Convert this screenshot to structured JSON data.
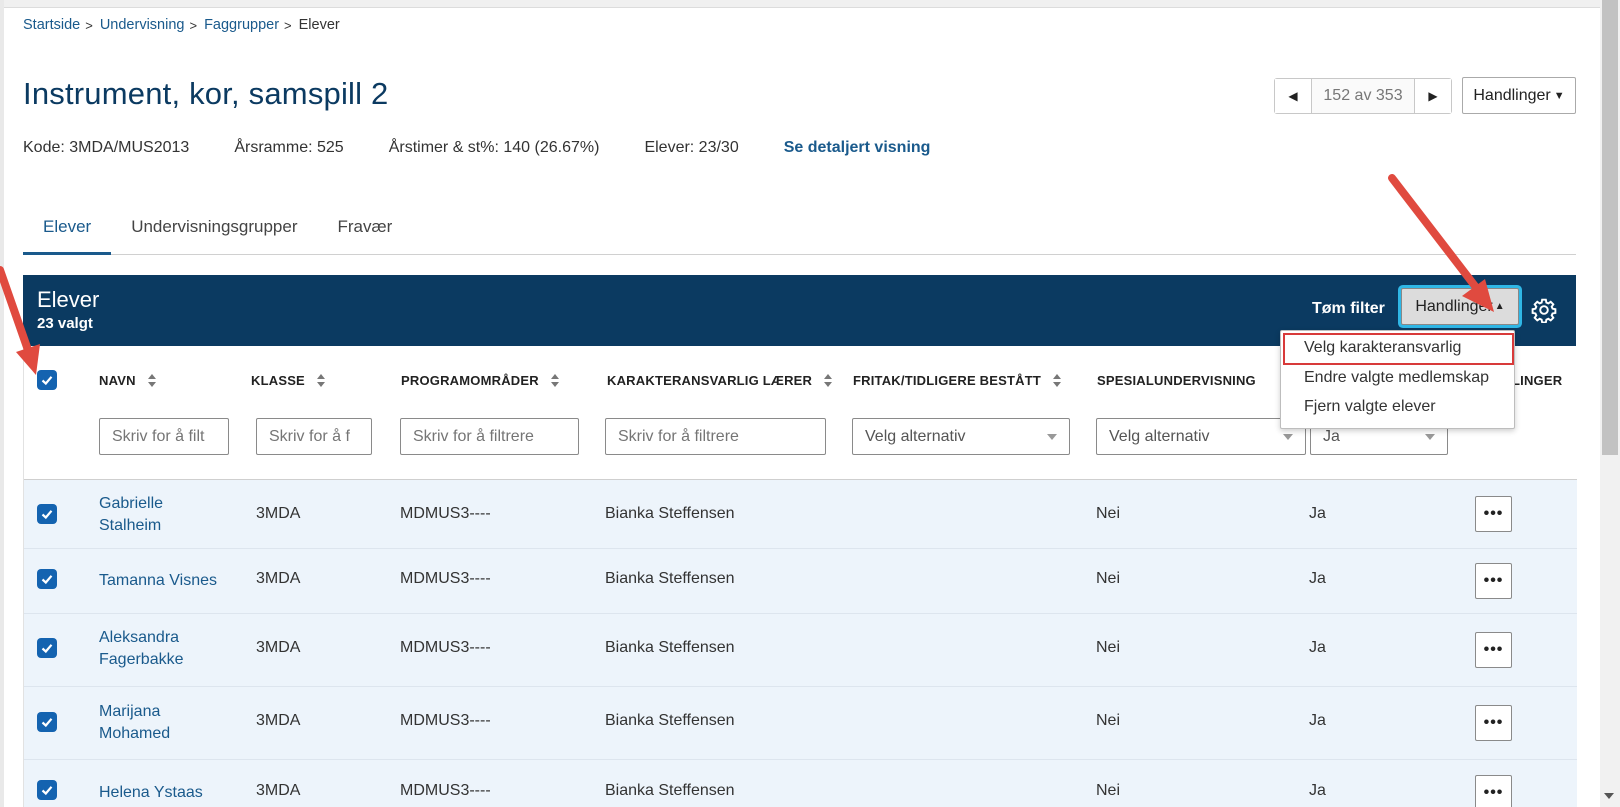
{
  "breadcrumb": [
    {
      "label": "Startside"
    },
    {
      "label": "Undervisning"
    },
    {
      "label": "Faggrupper"
    }
  ],
  "breadcrumb_current": "Elever",
  "page": {
    "title": "Instrument, kor, samspill 2",
    "pager": {
      "count": "152 av 353"
    },
    "actions_label": "Handlinger"
  },
  "meta": {
    "code": "Kode: 3MDA/MUS2013",
    "year_frame": "Årsramme: 525",
    "hours": "Årstimer & st%: 140 (26.67%)",
    "students": "Elever: 23/30",
    "detail_link": "Se detaljert visning"
  },
  "tabs": [
    "Elever",
    "Undervisningsgrupper",
    "Fravær"
  ],
  "panel": {
    "title": "Elever",
    "selected": "23 valgt",
    "clear_filter": "Tøm filter",
    "actions_label": "Handlinger"
  },
  "dropdown": {
    "items": [
      "Velg karakteransvarlig",
      "Endre valgte medlemskap",
      "Fjern valgte elever"
    ]
  },
  "columns": {
    "navn": "NAVN",
    "klasse": "KLASSE",
    "program": "PROGRAMOMRÅDER",
    "laerer": "KARAKTERANSVARLIG LÆRER",
    "fritak": "FRITAK/TIDLIGERE BESTÅTT",
    "spes": "SPESIALUNDERVISNING",
    "handlinger_partial": "LINGER"
  },
  "filters": {
    "navn_placeholder": "Skriv for å filt",
    "klasse_placeholder": "Skriv for å f",
    "program_placeholder": "Skriv for å filtrere",
    "laerer_placeholder": "Skriv for å filtrere",
    "fritak_select": "Velg alternativ",
    "spes_select": "Velg alternativ",
    "col7_select": "Ja"
  },
  "rows": [
    {
      "name_line1": "Gabrielle",
      "name_line2": "Stalheim",
      "klasse": "3MDA",
      "program": "MDMUS3----",
      "laerer": "Bianka Steffensen",
      "spes": "Nei",
      "col7": "Ja",
      "more": "•••"
    },
    {
      "name_line1": "Tamanna Visnes",
      "name_line2": "",
      "klasse": "3MDA",
      "program": "MDMUS3----",
      "laerer": "Bianka Steffensen",
      "spes": "Nei",
      "col7": "Ja",
      "more": "•••"
    },
    {
      "name_line1": "Aleksandra",
      "name_line2": "Fagerbakke",
      "klasse": "3MDA",
      "program": "MDMUS3----",
      "laerer": "Bianka Steffensen",
      "spes": "Nei",
      "col7": "Ja",
      "more": "•••"
    },
    {
      "name_line1": "Marijana",
      "name_line2": "Mohamed",
      "klasse": "3MDA",
      "program": "MDMUS3----",
      "laerer": "Bianka Steffensen",
      "spes": "Nei",
      "col7": "Ja",
      "more": "•••"
    },
    {
      "name_line1": "Helena Ystaas",
      "name_line2": "",
      "klasse": "3MDA",
      "program": "MDMUS3----",
      "laerer": "Bianka Steffensen",
      "spes": "Nei",
      "col7": "Ja",
      "more": "•••"
    }
  ],
  "colors": {
    "brand_dark": "#0b3a61",
    "link": "#1a5a8c",
    "checkbox": "#1463b0",
    "row_bg": "#edf4fb",
    "annotation_red": "#d83a3a",
    "focus_ring": "#2fb7e6"
  },
  "icons": [
    "chevron-left-icon",
    "chevron-right-icon",
    "caret-down-icon",
    "caret-up-icon",
    "gear-icon",
    "sort-icon",
    "checkbox-checked-icon",
    "more-icon"
  ]
}
